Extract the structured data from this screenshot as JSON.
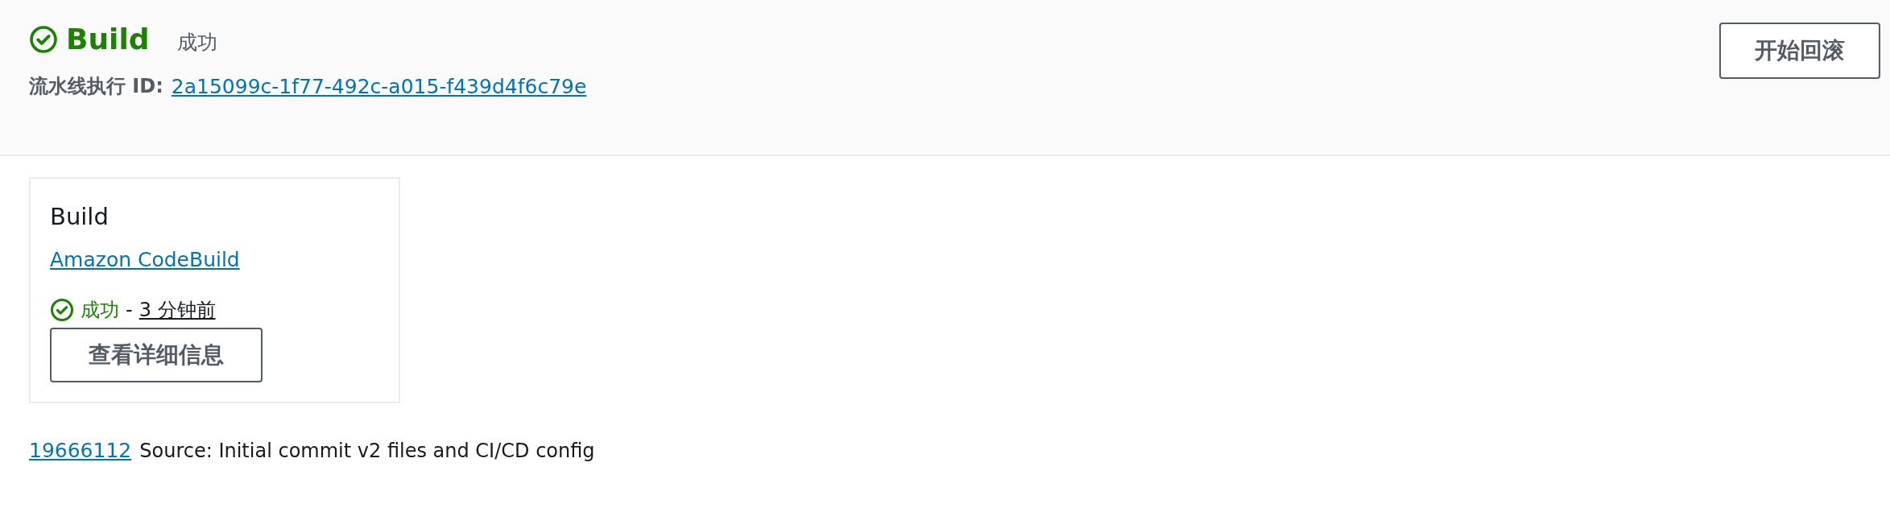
{
  "header": {
    "stage": "Build",
    "succeeded": true,
    "status_text": "成功",
    "execution_label": "流水线执行 ID:",
    "execution_id": "2a15099c-1f77-492c-a015-f439d4f6c79e",
    "rollback_button": "开始回滚"
  },
  "action_card": {
    "title": "Build",
    "provider": "Amazon CodeBuild",
    "succeeded": true,
    "status_text": "成功",
    "separator": "-",
    "time": "3 分钟前",
    "details_button": "查看详细信息"
  },
  "source": {
    "commit": "19666112",
    "message": "Source: Initial commit v2 files and CI/CD config"
  }
}
